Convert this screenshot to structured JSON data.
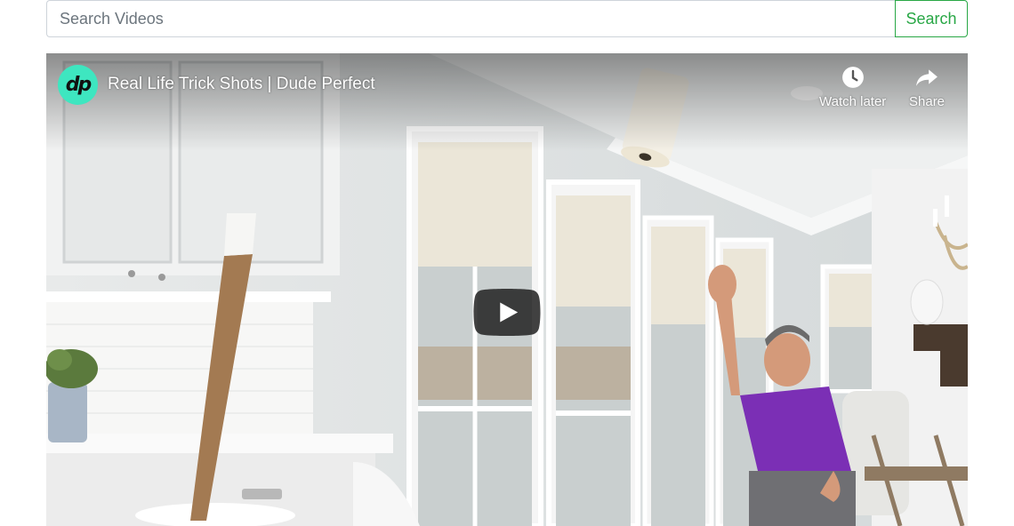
{
  "search": {
    "placeholder": "Search Videos",
    "value": "",
    "button_label": "Search"
  },
  "player": {
    "title": "Real Life Trick Shots | Dude Perfect",
    "channel_logo_text": "dp",
    "watch_later_label": "Watch later",
    "share_label": "Share"
  },
  "icons": {
    "channel": "channel-logo-icon",
    "watch_later": "clock-icon",
    "share": "share-arrow-icon",
    "play": "play-icon"
  },
  "colors": {
    "accent": "#28a745",
    "logo": "#3ee6c0",
    "play_bg": "#212121"
  }
}
